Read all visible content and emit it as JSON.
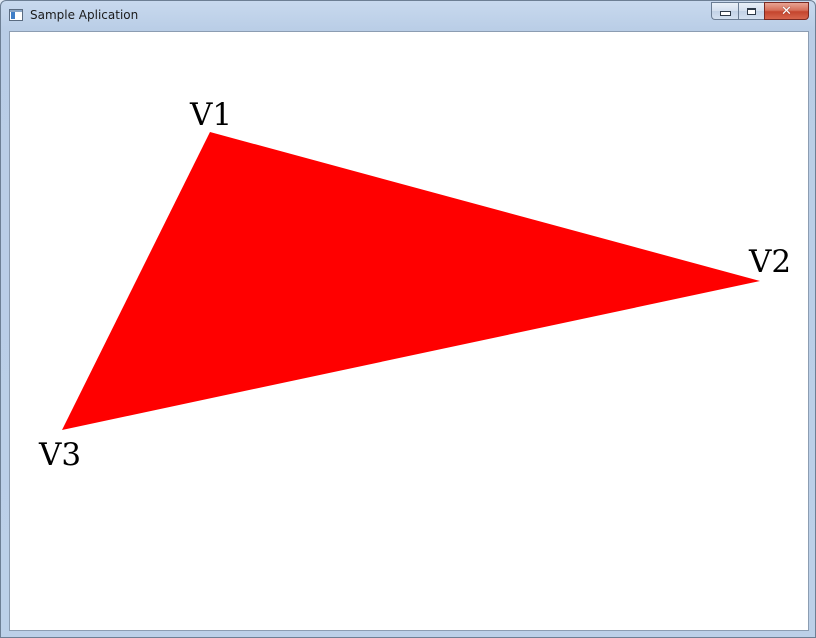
{
  "window": {
    "title": "Sample Aplication",
    "buttons": {
      "minimize_icon": "minimize-icon",
      "maximize_icon": "maximize-icon",
      "close_icon": "close-icon",
      "close_glyph": "✕"
    }
  },
  "canvas": {
    "background_color": "#ffffff",
    "triangle_color": "#ff0000",
    "vertex_labels": {
      "v1": "V1",
      "v2": "V2",
      "v3": "V3"
    }
  }
}
